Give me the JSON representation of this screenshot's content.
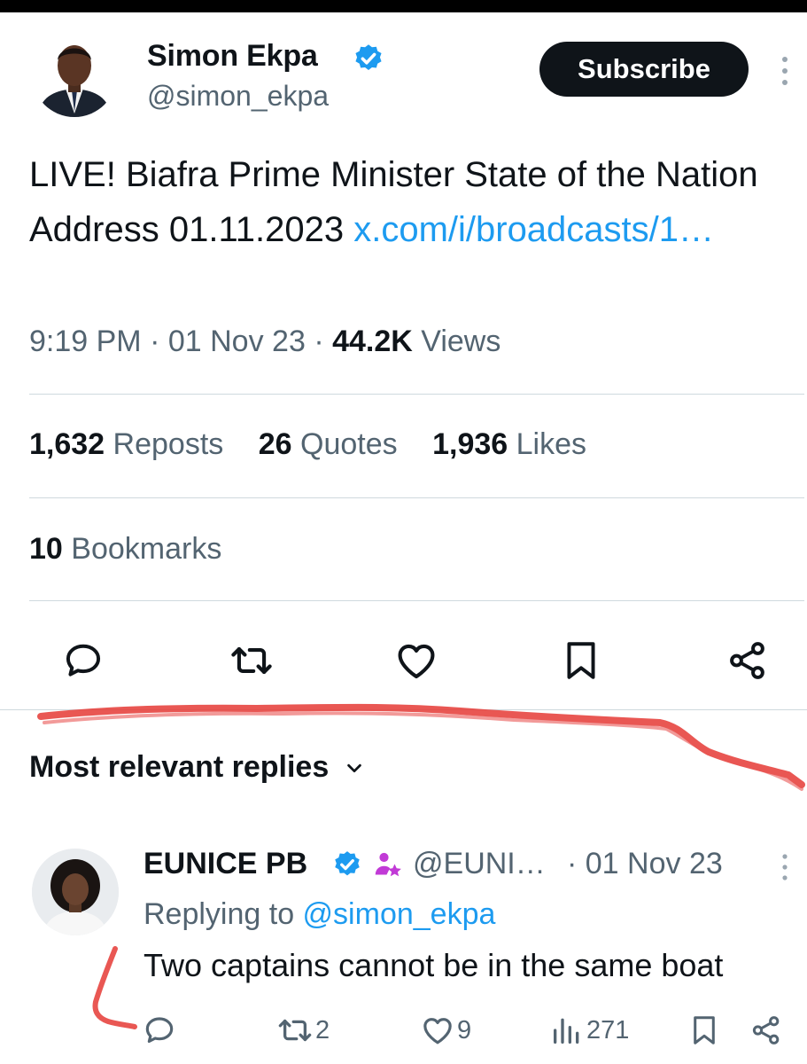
{
  "post": {
    "author": {
      "name": "Simon Ekpa",
      "handle": "@simon_ekpa",
      "subscribe_label": "Subscribe"
    },
    "text": "LIVE! Biafra Prime Minister State of the Nation Address 01.11.2023 ",
    "link_text": "x.com/i/broadcasts/1…",
    "time": "9:19 PM",
    "date": "01 Nov 23",
    "views_count": "44.2K",
    "views_label": "Views",
    "separator": "·",
    "stats": {
      "reposts_count": "1,632",
      "reposts_label": "Reposts",
      "quotes_count": "26",
      "quotes_label": "Quotes",
      "likes_count": "1,936",
      "likes_label": "Likes",
      "bookmarks_count": "10",
      "bookmarks_label": "Bookmarks"
    }
  },
  "replies": {
    "sort_label": "Most relevant replies",
    "items": [
      {
        "name": "EUNICE PB",
        "handle": "@EUNI…",
        "date": "· 01 Nov 23",
        "replying_prefix": "Replying to ",
        "replying_to": "@simon_ekpa",
        "text": "Two captains cannot be in the same boat",
        "reposts": "2",
        "likes": "9",
        "views": "271"
      }
    ]
  },
  "colors": {
    "accent": "#1d9bf0",
    "text": "#0f1419",
    "muted": "#536471",
    "divider": "#cfd9de",
    "annotation": "#e53935",
    "subscriber_badge": "#c13ad6"
  },
  "icons": [
    "verified-badge-icon",
    "more-vert-icon",
    "reply-icon",
    "repost-icon",
    "like-icon",
    "bookmark-icon",
    "share-icon",
    "chevron-down-icon",
    "subscriber-badge-icon",
    "views-icon"
  ]
}
